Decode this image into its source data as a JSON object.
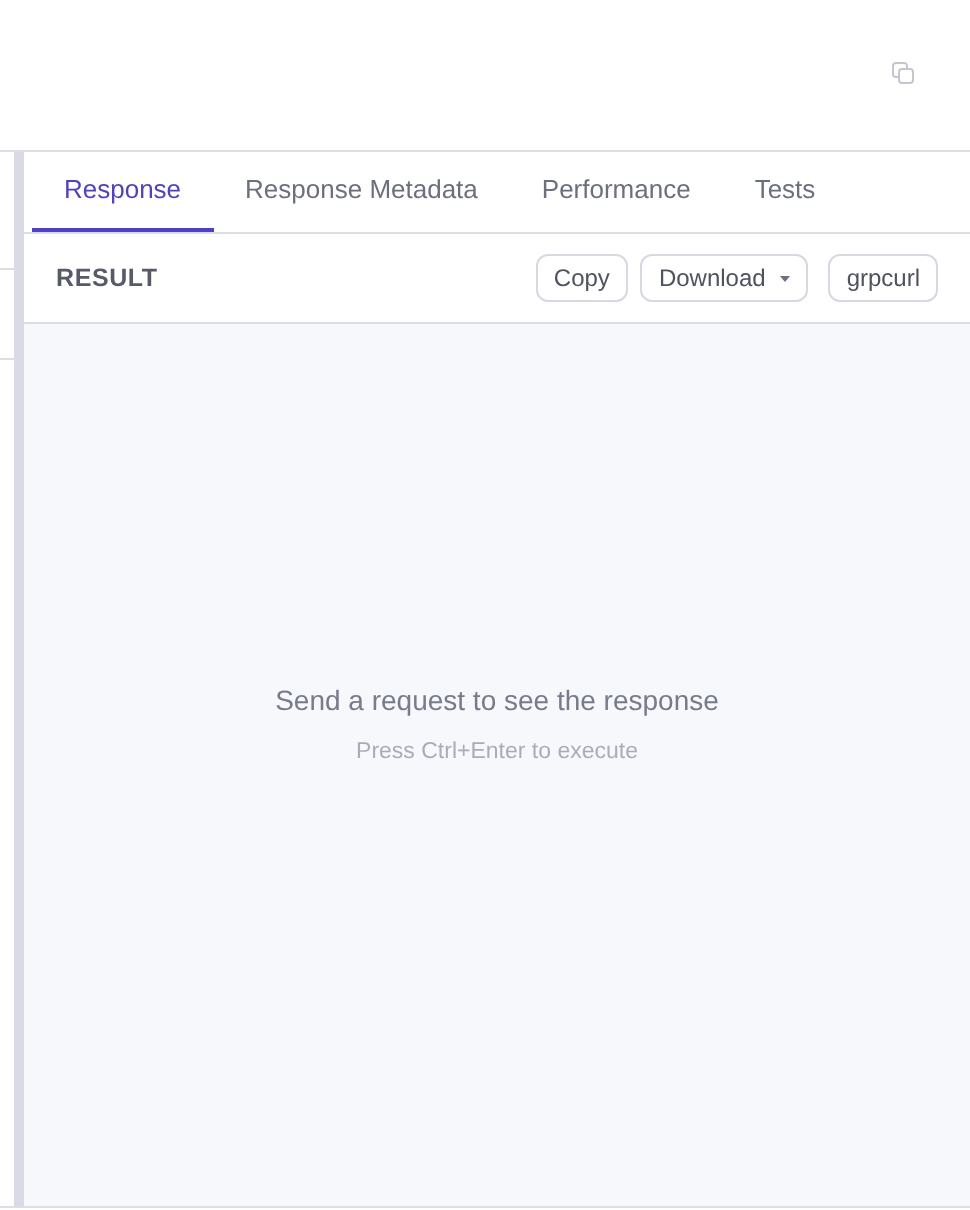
{
  "tabs": [
    {
      "label": "Response",
      "selected": true
    },
    {
      "label": "Response Metadata",
      "selected": false
    },
    {
      "label": "Performance",
      "selected": false
    },
    {
      "label": "Tests",
      "selected": false
    }
  ],
  "result": {
    "title": "RESULT",
    "buttons": [
      {
        "label": "Copy",
        "kind": "plain"
      },
      {
        "label": "Download",
        "kind": "dropdown"
      },
      {
        "label": "grpcurl",
        "kind": "plain"
      }
    ]
  },
  "empty_state": {
    "message": "Send a request to see the response",
    "hint": "Press Ctrl+Enter to execute"
  }
}
